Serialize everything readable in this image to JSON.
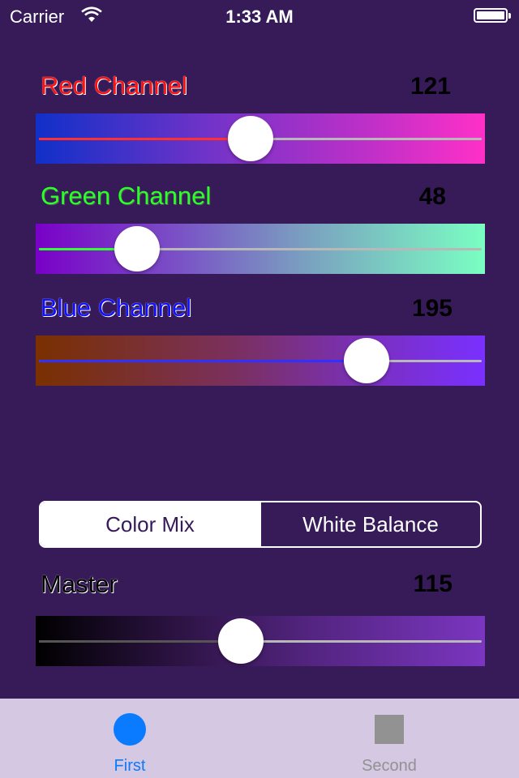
{
  "status_bar": {
    "carrier": "Carrier",
    "time": "1:33 AM"
  },
  "channels": {
    "red": {
      "label": "Red Channel",
      "value": "121",
      "fraction": 0.474
    },
    "green": {
      "label": "Green Channel",
      "value": "48",
      "fraction": 0.188
    },
    "blue": {
      "label": "Blue Channel",
      "value": "195",
      "fraction": 0.765
    }
  },
  "mode": {
    "options": [
      "Color Mix",
      "White Balance"
    ],
    "selected": "Color Mix"
  },
  "master": {
    "label": "Master",
    "value": "115",
    "fraction": 0.451
  },
  "tabs": [
    {
      "label": "First",
      "icon": "circle-icon",
      "selected": true
    },
    {
      "label": "Second",
      "icon": "square-icon",
      "selected": false
    }
  ],
  "colors": {
    "background": "#361b58",
    "tab_bar": "#d4c8e2",
    "accent": "#0a7aff",
    "inactive": "#929292",
    "red_label": "#ff1010",
    "green_label": "#2aff2a",
    "blue_label": "#1010ff"
  }
}
